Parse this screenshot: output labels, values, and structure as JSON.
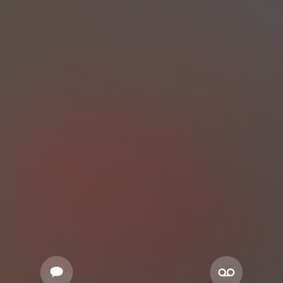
{
  "screen": {
    "background_colors": [
      "#5a4e48",
      "#614742",
      "#524846"
    ]
  },
  "actions": {
    "message": {
      "icon": "message-bubble-icon"
    },
    "voicemail": {
      "icon": "voicemail-icon"
    }
  }
}
